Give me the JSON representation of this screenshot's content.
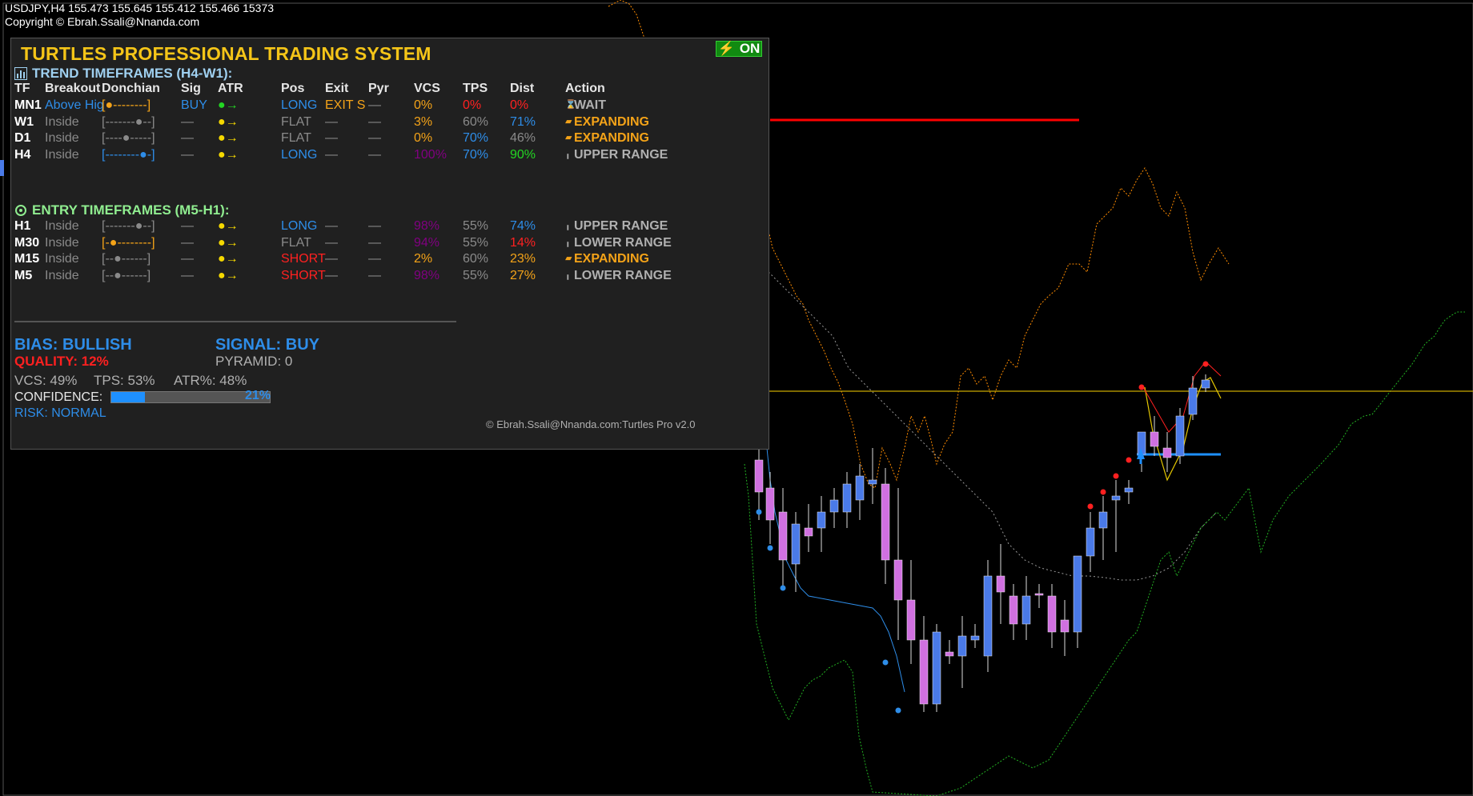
{
  "chart_header": {
    "symbol_line": "USDJPY,H4  155.473 155.645 155.412 155.466  15373",
    "copyright_line": "Copyright © Ebrah.Ssali@Nnanda.com"
  },
  "panel": {
    "title": "TURTLES PROFESSIONAL TRADING SYSTEM",
    "on_label": "ON",
    "trend_section_title": "TREND TIMEFRAMES (H4-W1):",
    "entry_section_title": "ENTRY TIMEFRAMES (M5-H1):",
    "headers": {
      "tf": "TF",
      "breakout": "Breakout",
      "donchian": "Donchian",
      "sig": "Sig",
      "atr": "ATR",
      "pos": "Pos",
      "exit": "Exit",
      "pyr": "Pyr",
      "vcs": "VCS",
      "tps": "TPS",
      "dist": "Dist",
      "action": "Action"
    },
    "trend_rows": [
      {
        "tf": "MN1",
        "breakout": "Above Hig",
        "donchian": "[●--------]",
        "sig": "BUY",
        "atr": "●→",
        "pos": "LONG",
        "exit": "EXIT S",
        "pyr": "—",
        "vcs": "0%",
        "tps": "0%",
        "dist": "0%",
        "action_icon": "⌛",
        "action": "WAIT"
      },
      {
        "tf": "W1",
        "breakout": "Inside",
        "donchian": "[-------●--]",
        "sig": "—",
        "atr": "●→",
        "pos": "FLAT",
        "exit": "—",
        "pyr": "—",
        "vcs": "3%",
        "tps": "60%",
        "dist": "71%",
        "action_icon": "▰",
        "action": "EXPANDING"
      },
      {
        "tf": "D1",
        "breakout": "Inside",
        "donchian": "[----●-----]",
        "sig": "—",
        "atr": "●→",
        "pos": "FLAT",
        "exit": "—",
        "pyr": "—",
        "vcs": "0%",
        "tps": "70%",
        "dist": "46%",
        "action_icon": "▰",
        "action": "EXPANDING"
      },
      {
        "tf": "H4",
        "breakout": "Inside",
        "donchian": "[--------●-]",
        "sig": "—",
        "atr": "●→",
        "pos": "LONG",
        "exit": "—",
        "pyr": "—",
        "vcs": "100%",
        "tps": "70%",
        "dist": "90%",
        "action_icon": "╻",
        "action": "UPPER RANGE"
      }
    ],
    "entry_rows": [
      {
        "tf": "H1",
        "breakout": "Inside",
        "donchian": "[-------●--]",
        "sig": "—",
        "atr": "●→",
        "pos": "LONG",
        "exit": "—",
        "pyr": "—",
        "vcs": "98%",
        "tps": "55%",
        "dist": "74%",
        "action_icon": "╻",
        "action": "UPPER RANGE"
      },
      {
        "tf": "M30",
        "breakout": "Inside",
        "donchian": "[-●--------]",
        "sig": "—",
        "atr": "●→",
        "pos": "FLAT",
        "exit": "—",
        "pyr": "—",
        "vcs": "94%",
        "tps": "55%",
        "dist": "14%",
        "action_icon": "╻",
        "action": "LOWER RANGE"
      },
      {
        "tf": "M15",
        "breakout": "Inside",
        "donchian": "[--●------]",
        "sig": "—",
        "atr": "●→",
        "pos": "SHORT",
        "exit": "—",
        "pyr": "—",
        "vcs": "2%",
        "tps": "60%",
        "dist": "23%",
        "action_icon": "▰",
        "action": "EXPANDING"
      },
      {
        "tf": "M5",
        "breakout": "Inside",
        "donchian": "[--●------]",
        "sig": "—",
        "atr": "●→",
        "pos": "SHORT",
        "exit": "—",
        "pyr": "—",
        "vcs": "98%",
        "tps": "55%",
        "dist": "27%",
        "action_icon": "╻",
        "action": "LOWER RANGE"
      }
    ],
    "bias": "BIAS: BULLISH",
    "signal": "SIGNAL: BUY",
    "quality": "QUALITY: 12%",
    "pyramid": "PYRAMID: 0",
    "metrics": {
      "vcs": "VCS: 49%",
      "tps": "TPS: 53%",
      "atr": "ATR%: 48%"
    },
    "confidence_label": "CONFIDENCE:",
    "confidence_pct": "21%",
    "confidence_value": 0.21,
    "risk": "RISK: NORMAL",
    "copyright": "© Ebrah.Ssali@Nnanda.com:Turtles Pro v2.0"
  },
  "colors": {
    "bull_candle": "#4a7ae8",
    "bear_candle": "#d070e0",
    "donchian_upper": "#ff8c00",
    "donchian_lower": "#22b022",
    "middle_line": "#bbbbbb",
    "price_line": "#c8a800",
    "resistance_line": "#ff0000"
  }
}
